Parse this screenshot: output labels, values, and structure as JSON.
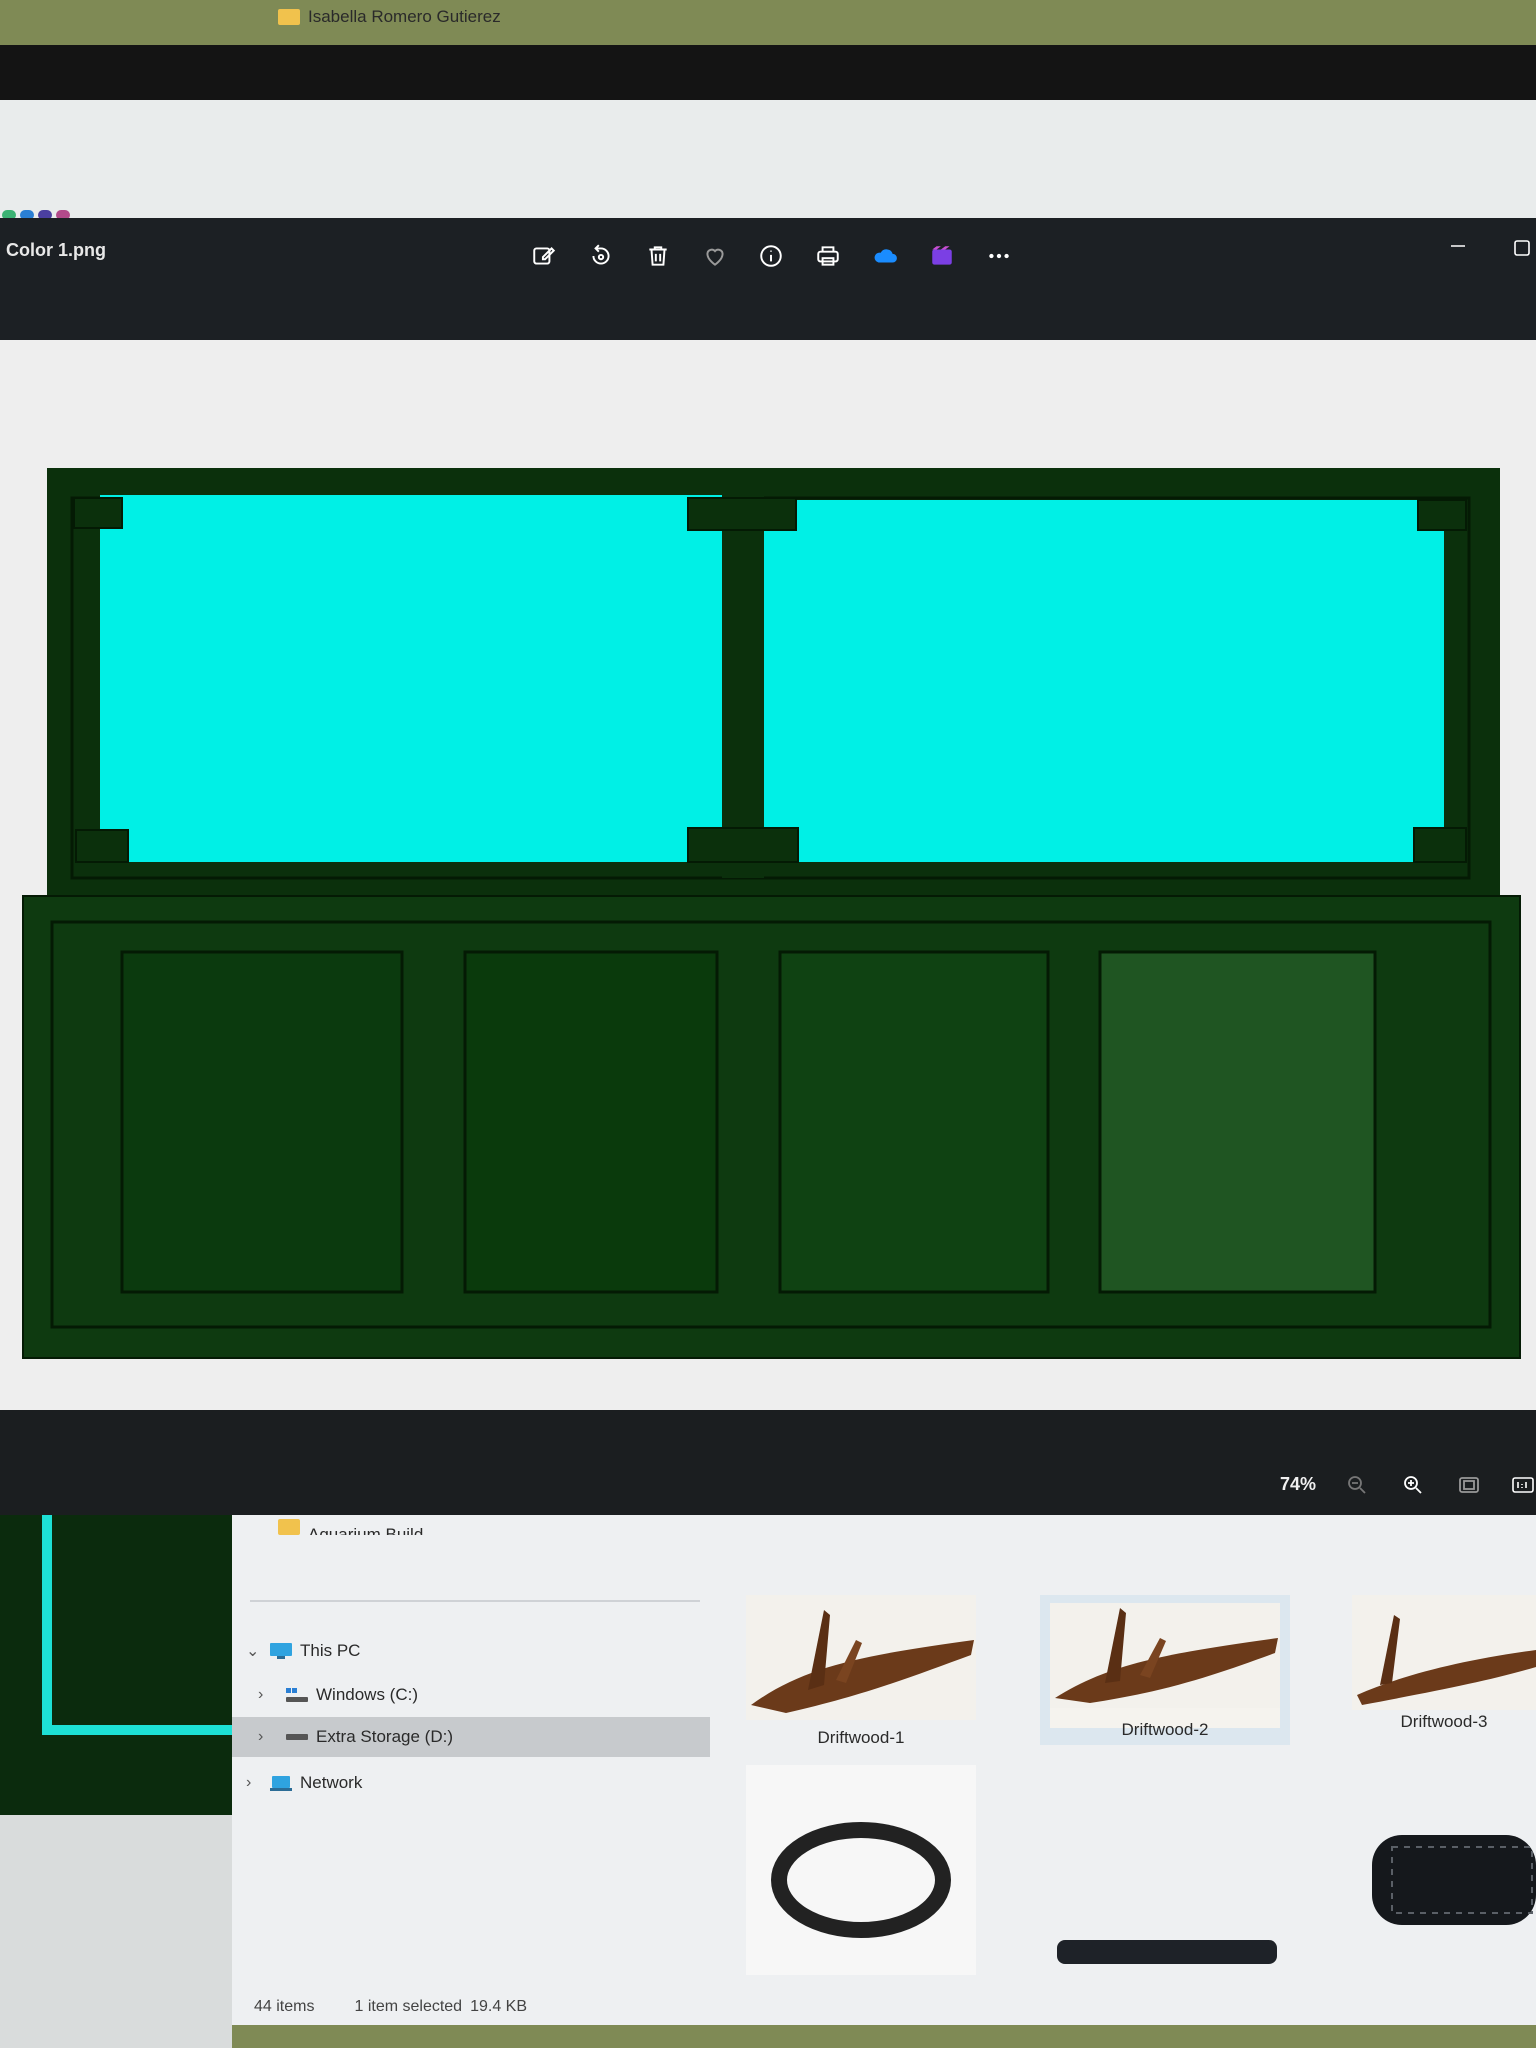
{
  "app": {
    "title": "Color 1.png",
    "toolbar": [
      {
        "name": "edit-icon"
      },
      {
        "name": "rotate-icon"
      },
      {
        "name": "delete-icon"
      },
      {
        "name": "favorite-heart-icon"
      },
      {
        "name": "info-icon"
      },
      {
        "name": "print-icon"
      },
      {
        "name": "onedrive-cloud-icon"
      },
      {
        "name": "clipchamp-video-icon"
      },
      {
        "name": "more-options-icon"
      }
    ],
    "zoom": {
      "level": "74%"
    }
  },
  "image": {
    "colors": {
      "cabinet": "#0e3a10",
      "cabinet_dark": "#062306",
      "glass": "#00f0e6",
      "background": "#eeeeee"
    }
  },
  "explorer": {
    "nav": {
      "folders": [
        {
          "label": "Aquarium Build"
        },
        {
          "label": "Isabella Romero Gutierez"
        }
      ],
      "this_pc": "This PC",
      "drives": [
        {
          "label": "Windows (C:)"
        },
        {
          "label": "Extra Storage (D:)"
        }
      ],
      "network": "Network"
    },
    "files": [
      {
        "label": "Driftwood-1"
      },
      {
        "label": "Driftwood-2"
      },
      {
        "label": "Driftwood-3"
      }
    ],
    "status": {
      "count": "44 items",
      "selected": "1 item selected",
      "size": "19.4 KB"
    }
  }
}
